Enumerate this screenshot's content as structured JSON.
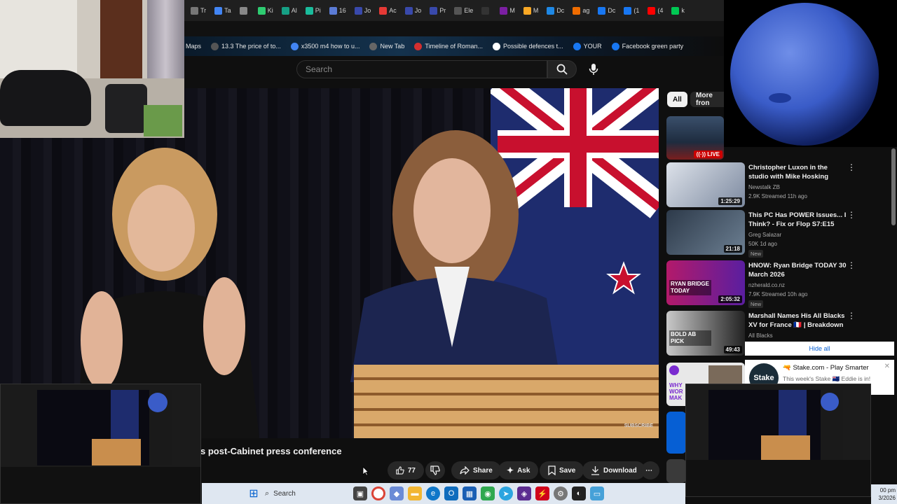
{
  "tabs": [
    "Tr",
    "Ta",
    "",
    "Ki",
    "Al",
    "Pi",
    "16",
    "Jo",
    "Ac",
    "Jo",
    "Pr",
    "Ele",
    "",
    "M",
    "M",
    "Dc",
    "ag",
    "Dc",
    "(1",
    "(4",
    "k"
  ],
  "bookmarks": [
    "Maps",
    "13.3 The price of to...",
    "x3500 m4 how to u...",
    "New Tab",
    "Timeline of Roman...",
    "Possible defences t...",
    "YOUR",
    "Facebook green party"
  ],
  "search": {
    "placeholder": "Search"
  },
  "video": {
    "title": "s post-Cabinet press conference",
    "watermark": "SUBSCRIBE"
  },
  "actions": {
    "like_count": "77",
    "share": "Share",
    "ask": "Ask",
    "save": "Save",
    "download": "Download"
  },
  "chips": {
    "all": "All",
    "more": "More fron"
  },
  "live_badge": "LIVE",
  "recommendations": [
    {
      "title": "Christopher Luxon in the studio with Mike Hosking",
      "channel": "Newstalk ZB",
      "meta": "2.9K  Streamed 11h ago",
      "duration": "1:25:29",
      "new": ""
    },
    {
      "title": "This PC Has POWER Issues... I Think? - Fix or Flop S7:E15",
      "channel": "Greg Salazar",
      "meta": "50K  1d ago",
      "duration": "21:18",
      "new": "New"
    },
    {
      "title": "HNOW: Ryan Bridge TODAY 30 March 2026",
      "channel": "nzherald.co.nz",
      "meta": "7.9K  Streamed 10h ago",
      "duration": "2:05:32",
      "new": "New",
      "thumb_text": "RYAN BRIDGE TODAY"
    },
    {
      "title": "Marshall Names His All Blacks XV for France 🇫🇷 | Breakdown",
      "channel": "All Blacks",
      "meta": "",
      "duration": "49:43",
      "new": "",
      "thumb_text": "BOLD AB PICK"
    }
  ],
  "hide_all": "Hide all",
  "ad": {
    "title": "Stake.com - Play Smarter",
    "body": "This week's Stake",
    "body2": "Eddie is in!",
    "logo": "Stake",
    "side_thumb_text": "WHY WOR MAK"
  },
  "taskbar": {
    "search": "Search",
    "clock_time": "00 pm",
    "clock_date": "3/2026"
  }
}
